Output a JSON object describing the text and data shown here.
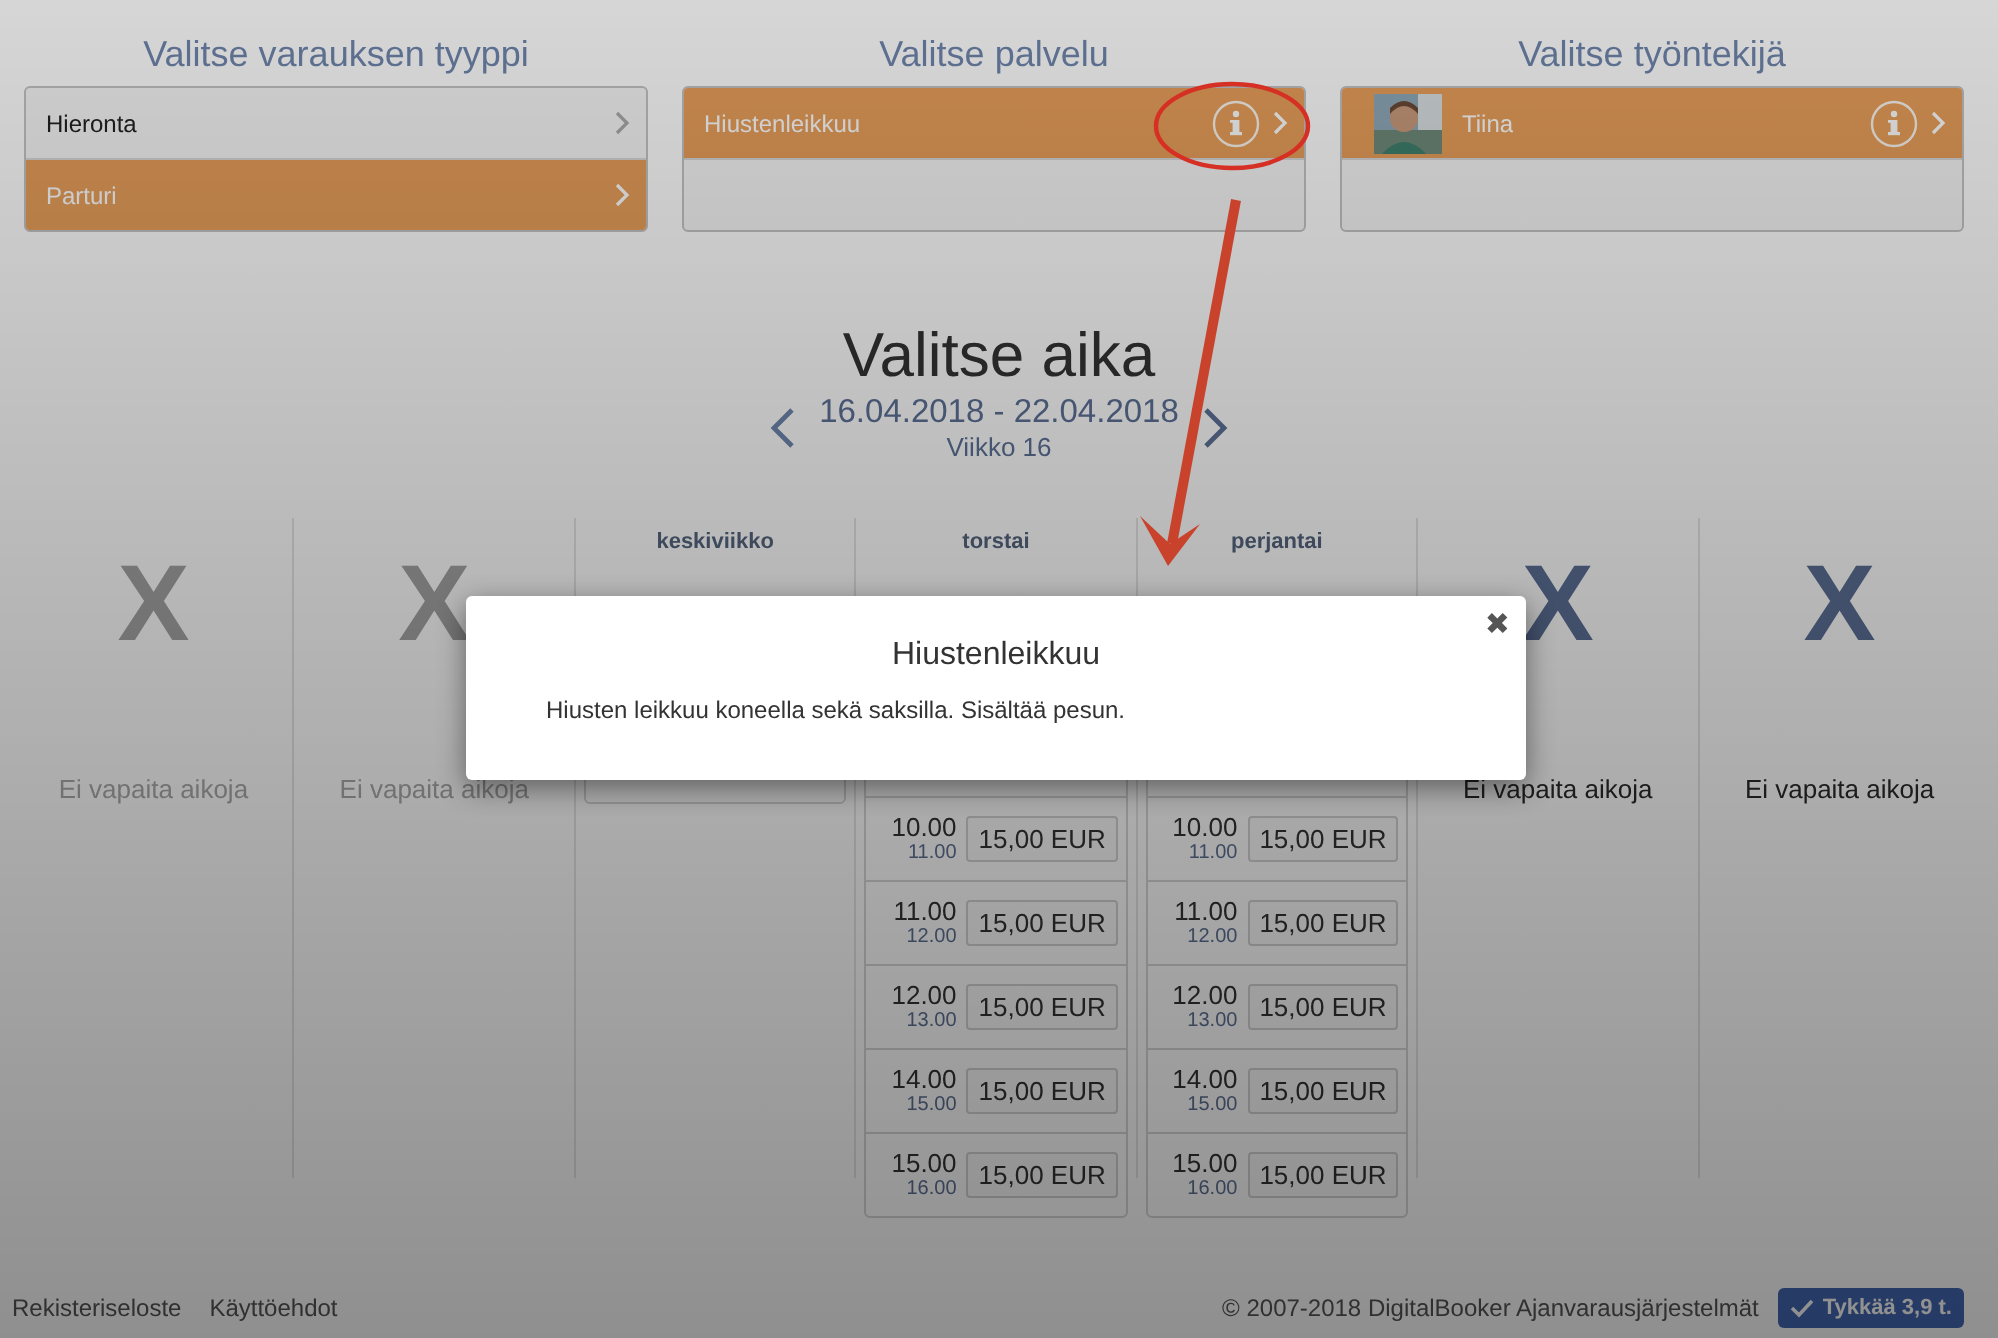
{
  "sections": [
    {
      "title": "Valitse varauksen tyyppi",
      "items": [
        {
          "label": "Hieronta",
          "selected": false,
          "info": false
        },
        {
          "label": "Parturi",
          "selected": true,
          "info": false
        }
      ]
    },
    {
      "title": "Valitse palvelu",
      "items": [
        {
          "label": "Hiustenleikkuu",
          "selected": true,
          "info": true
        }
      ]
    },
    {
      "title": "Valitse työntekijä",
      "items": [
        {
          "label": "Tiina",
          "selected": true,
          "info": true
        }
      ]
    }
  ],
  "schedule": {
    "title": "Valitse aika",
    "range": "16.04.2018 - 22.04.2018",
    "week": "Viikko 16",
    "days": [
      {
        "kind": "closed",
        "past": true,
        "mark": "X",
        "message": "Ei vapaita aikoja"
      },
      {
        "kind": "closed",
        "past": true,
        "mark": "X",
        "message": "Ei vapaita aikoja"
      },
      {
        "kind": "open",
        "name": "keskiviikko"
      },
      {
        "kind": "open",
        "name": "torstai",
        "slots": [
          {
            "start": "10.00",
            "end": "11.00",
            "price": "15,00 EUR"
          },
          {
            "start": "11.00",
            "end": "12.00",
            "price": "15,00 EUR"
          },
          {
            "start": "12.00",
            "end": "13.00",
            "price": "15,00 EUR"
          },
          {
            "start": "14.00",
            "end": "15.00",
            "price": "15,00 EUR"
          },
          {
            "start": "15.00",
            "end": "16.00",
            "price": "15,00 EUR"
          }
        ]
      },
      {
        "kind": "open",
        "name": "perjantai",
        "slots": [
          {
            "start": "10.00",
            "end": "11.00",
            "price": "15,00 EUR"
          },
          {
            "start": "11.00",
            "end": "12.00",
            "price": "15,00 EUR"
          },
          {
            "start": "12.00",
            "end": "13.00",
            "price": "15,00 EUR"
          },
          {
            "start": "14.00",
            "end": "15.00",
            "price": "15,00 EUR"
          },
          {
            "start": "15.00",
            "end": "16.00",
            "price": "15,00 EUR"
          }
        ]
      },
      {
        "kind": "closed",
        "past": false,
        "mark": "X",
        "message": "Ei vapaita aikoja"
      },
      {
        "kind": "closed",
        "past": false,
        "mark": "X",
        "message": "Ei vapaita aikoja"
      }
    ]
  },
  "modal": {
    "title": "Hiustenleikkuu",
    "text": "Hiusten leikkuu koneella sekä saksilla. Sisältää pesun.",
    "close": "✖"
  },
  "footer": {
    "links": [
      "Rekisteriseloste",
      "Käyttöehdot"
    ],
    "copyright": "© 2007-2018 DigitalBooker Ajanvarausjärjestelmät",
    "like": "Tykkää 3,9 t."
  }
}
